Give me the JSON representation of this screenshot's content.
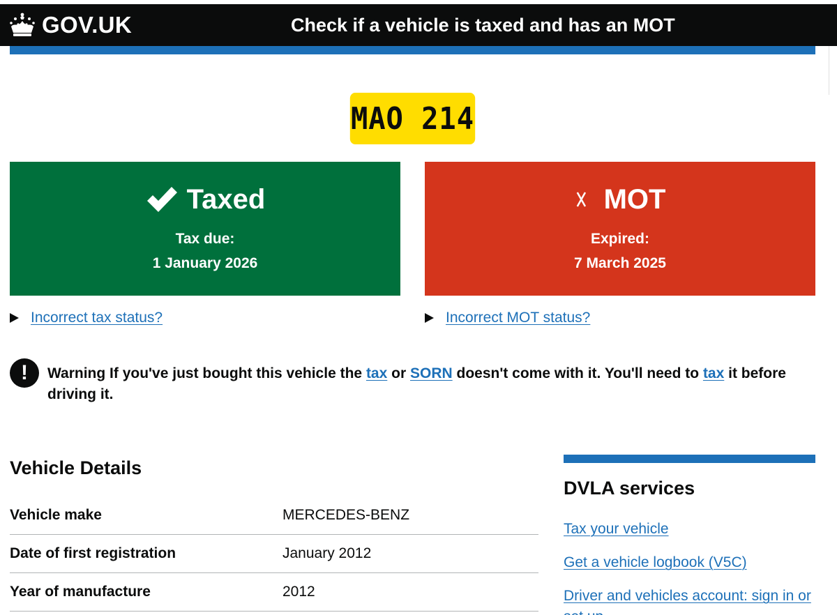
{
  "header": {
    "logo_text": "GOV.UK",
    "service_name": "Check if a vehicle is taxed and has an MOT"
  },
  "vehicle": {
    "registration": "MAO 214"
  },
  "tax_status": {
    "title": "Taxed",
    "label": "Tax due:",
    "date": "1 January 2026",
    "icon": "check-icon",
    "color": "#00703c",
    "link": "Incorrect tax status?"
  },
  "mot_status": {
    "title": "MOT",
    "label": "Expired:",
    "date": "7 March 2025",
    "icon": "cross-icon",
    "color": "#d4351c",
    "link": "Incorrect MOT status?"
  },
  "warning": {
    "prefix": "Warning If you've just bought this vehicle the",
    "link_tax": "tax",
    "or_text": "or",
    "link_sorn": "SORN",
    "middle": "doesn't come with it. You'll need to",
    "link_tax2": "tax",
    "suffix": "it before driving it."
  },
  "vehicle_details": {
    "title": "Vehicle Details",
    "rows": [
      {
        "key": "Vehicle make",
        "value": "MERCEDES-BENZ"
      },
      {
        "key": "Date of first registration",
        "value": "January 2012"
      },
      {
        "key": "Year of manufacture",
        "value": "2012"
      }
    ]
  },
  "dvla_services": {
    "title": "DVLA services",
    "links": [
      "Tax your vehicle",
      "Get a vehicle logbook (V5C)",
      "Driver and vehicles account: sign in or set up"
    ]
  },
  "colors": {
    "header_bg": "#0b0c0c",
    "brand_blue": "#1d70b8",
    "plate_yellow": "#ffdd00",
    "link": "#1d70b8"
  }
}
